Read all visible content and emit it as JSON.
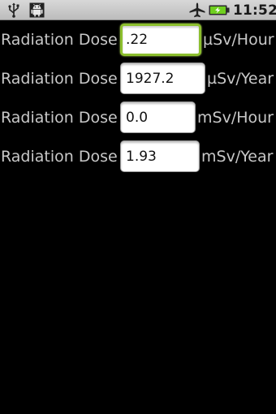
{
  "status_bar": {
    "time": "11:52",
    "icons": [
      "usb-icon",
      "android-debug-icon",
      "airplane-mode-icon",
      "battery-charging-icon"
    ],
    "battery_color": "#6fcf1f"
  },
  "rows": [
    {
      "label": "Radiation Dose",
      "value": ".22",
      "unit": "µSv/Hour",
      "focused": true
    },
    {
      "label": "Radiation Dose",
      "value": "1927.2",
      "unit": "µSv/Year",
      "focused": false
    },
    {
      "label": "Radiation Dose",
      "value": "0.0",
      "unit": "mSv/Hour",
      "focused": false
    },
    {
      "label": "Radiation Dose",
      "value": "1.93",
      "unit": "mSv/Year",
      "focused": false
    }
  ],
  "colors": {
    "background": "#000000",
    "label_text": "#c8c8c8",
    "focus_border": "#8cbf2e"
  }
}
